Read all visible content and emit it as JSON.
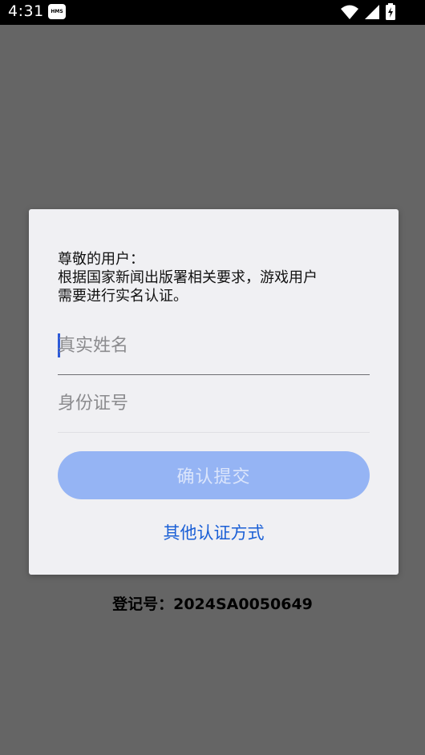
{
  "status_bar": {
    "time": "4:31",
    "badge_text": "HMS",
    "icons": [
      "wifi-icon",
      "cellular-signal-icon",
      "battery-charging-icon"
    ]
  },
  "background": {
    "registration_text": "登记号：2024SA0050649"
  },
  "dialog": {
    "greeting": "尊敬的用户：",
    "notice_line1": "根据国家新闻出版署相关要求，游戏用户",
    "notice_line2": "需要进行实名认证。",
    "name_field": {
      "placeholder": "真实姓名",
      "value": ""
    },
    "id_field": {
      "placeholder": "身份证号",
      "value": ""
    },
    "confirm_label": "确认提交",
    "other_method_label": "其他认证方式"
  },
  "colors": {
    "overlay": "#656565",
    "dialog_bg": "#f0f0f3",
    "button_bg": "#95b4f4",
    "button_text": "#dbe5fb",
    "link": "#1a5fd6",
    "caret": "#2d5ad8"
  }
}
